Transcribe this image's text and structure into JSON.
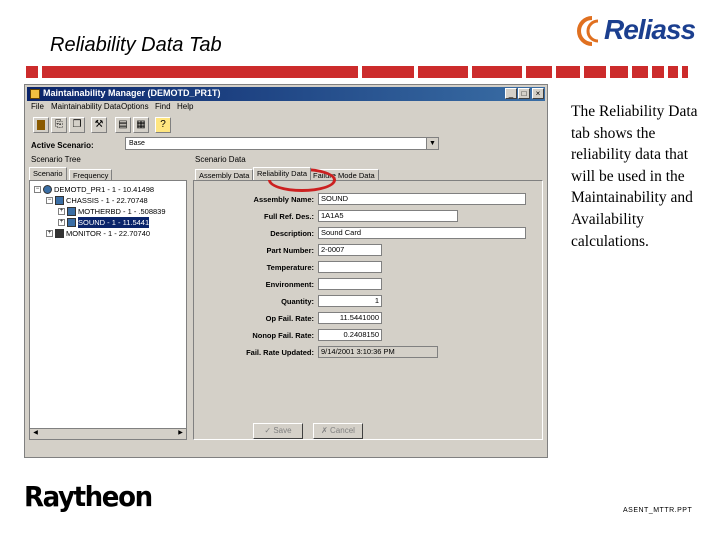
{
  "slide": {
    "title": "Reliability Data Tab",
    "logo_text": "Reliass",
    "description": "The Reliability Data tab shows the reliability data that will be used in the Maintainability and Availability calculations.",
    "brand": "Raytheon",
    "filename": "ASENT_MTTR.PPT",
    "accent_color": "#cc2b2b"
  },
  "window": {
    "title": "Maintainability Manager (DEMOTD_PR1T)",
    "minimize": "_",
    "maximize": "□",
    "close": "×"
  },
  "menu": [
    "File",
    "Maintainability Data",
    "Options",
    "Find",
    "Help"
  ],
  "active_scenario": {
    "label": "Active Scenario:",
    "value": "Base"
  },
  "scenario_tree": {
    "title": "Scenario Tree",
    "tabs": [
      "Scenario",
      "Frequency"
    ],
    "nodes": [
      {
        "label": "DEMOTD_PR1 - 1 - 10.41498"
      },
      {
        "label": "CHASSIS - 1 - 22.70748"
      },
      {
        "label": "MOTHERBD - 1 - .508839"
      },
      {
        "label": "SOUND - 1 - 11.5441"
      },
      {
        "label": "MONITOR - 1 - 22.70740"
      }
    ]
  },
  "scenario_data": {
    "title": "Scenario Data",
    "tabs": [
      "Assembly Data",
      "Reliability Data",
      "Failure Mode Data"
    ],
    "fields": [
      {
        "label": "Assembly Name:",
        "value": "SOUND"
      },
      {
        "label": "Full Ref. Des.:",
        "value": "1A1A5"
      },
      {
        "label": "Description:",
        "value": "Sound Card"
      },
      {
        "label": "Part Number:",
        "value": "2-0007"
      },
      {
        "label": "Temperature:",
        "value": ""
      },
      {
        "label": "Environment:",
        "value": ""
      },
      {
        "label": "Quantity:",
        "value": "1"
      },
      {
        "label": "Op Fail. Rate:",
        "value": "11.5441000"
      },
      {
        "label": "Nonop Fail. Rate:",
        "value": "0.2408150"
      },
      {
        "label": "Fail. Rate Updated:",
        "value": "9/14/2001 3:10:36 PM"
      }
    ],
    "save": "Save",
    "cancel": "Cancel"
  },
  "icons": [
    "book-icon",
    "new-icon",
    "copy-icon",
    "tools-icon",
    "report-icon",
    "grid-icon",
    "help-icon"
  ]
}
